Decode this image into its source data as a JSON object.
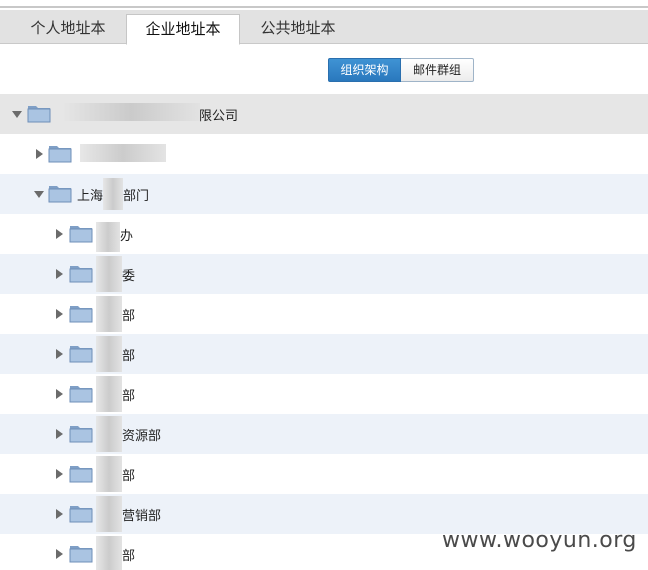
{
  "tabs": [
    {
      "label": "个人地址本"
    },
    {
      "label": "企业地址本"
    },
    {
      "label": "公共地址本"
    }
  ],
  "view_toggle": {
    "org_label": "组织架构",
    "mail_group_label": "邮件群组"
  },
  "tree": {
    "root": {
      "label_prefix": "",
      "label_suffix": "限公司",
      "expanded": true
    },
    "rows": [
      {
        "label": "",
        "expanded": false
      },
      {
        "label_prefix": "上海",
        "label_suffix": "部门",
        "expanded": true
      },
      {
        "label": "办",
        "expanded": false
      },
      {
        "label": "委",
        "expanded": false
      },
      {
        "label": "部",
        "expanded": false
      },
      {
        "label": "部",
        "expanded": false
      },
      {
        "label": "部",
        "expanded": false
      },
      {
        "label": "资源部",
        "expanded": false
      },
      {
        "label": "部",
        "expanded": false
      },
      {
        "label": "营销部",
        "expanded": false
      },
      {
        "label": "部",
        "expanded": false
      }
    ]
  },
  "watermark": "www.wooyun.org",
  "colors": {
    "accent": "#2a78bd",
    "folder": "#9cb9da",
    "row_alt": "#edf2f9"
  }
}
